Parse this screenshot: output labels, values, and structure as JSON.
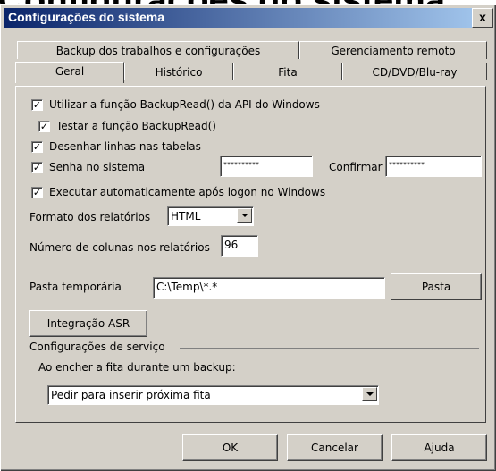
{
  "window": {
    "title": "Configurações do sistema",
    "close_label": "x"
  },
  "background_title": "Configurações do sistema",
  "tabs_back": [
    {
      "label": "Backup dos trabalhos e configurações"
    },
    {
      "label": "Gerenciamento remoto"
    }
  ],
  "tabs_front": [
    {
      "label": "Geral"
    },
    {
      "label": "Histórico"
    },
    {
      "label": "Fita"
    },
    {
      "label": "CD/DVD/Blu-ray"
    }
  ],
  "options": {
    "backupread": {
      "label": "Utilizar a função BackupRead() da API do Windows",
      "checked": true
    },
    "test_backupread": {
      "label": "Testar a função BackupRead()",
      "checked": true
    },
    "draw_lines": {
      "label": "Desenhar linhas nas tabelas",
      "checked": true
    },
    "password": {
      "label": "Senha no sistema",
      "checked": true,
      "value": "**********",
      "confirm_label": "Confirmar",
      "confirm_value": "**********"
    },
    "autorun": {
      "label": "Executar automaticamente após logon no Windows",
      "checked": true
    }
  },
  "report_format": {
    "label": "Formato dos relatórios",
    "value": "HTML"
  },
  "report_columns": {
    "label": "Número de colunas nos relatórios",
    "value": "96"
  },
  "temp_folder": {
    "label": "Pasta temporária",
    "value": "C:\\Temp\\*.*",
    "button": "Pasta"
  },
  "asr_button": "Integração ASR",
  "service": {
    "group_label": "Configurações de serviço",
    "tape_full_label": "Ao encher a fita durante um backup:",
    "tape_full_value": "Pedir para inserir próxima fita"
  },
  "footer": {
    "ok": "OK",
    "cancel": "Cancelar",
    "help": "Ajuda"
  }
}
